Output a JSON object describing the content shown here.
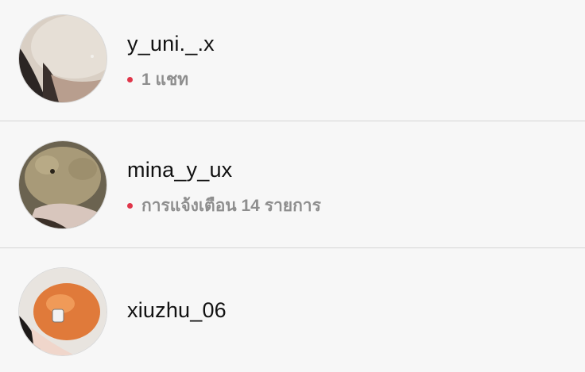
{
  "accounts": [
    {
      "username": "y_uni._.x",
      "status": "1 แชท",
      "has_unread": true,
      "dot_color": "#e0364a"
    },
    {
      "username": "mina_y_ux",
      "status": "การแจ้งเตือน 14 รายการ",
      "has_unread": true,
      "dot_color": "#e0364a"
    },
    {
      "username": "xiuzhu_06"
    }
  ]
}
